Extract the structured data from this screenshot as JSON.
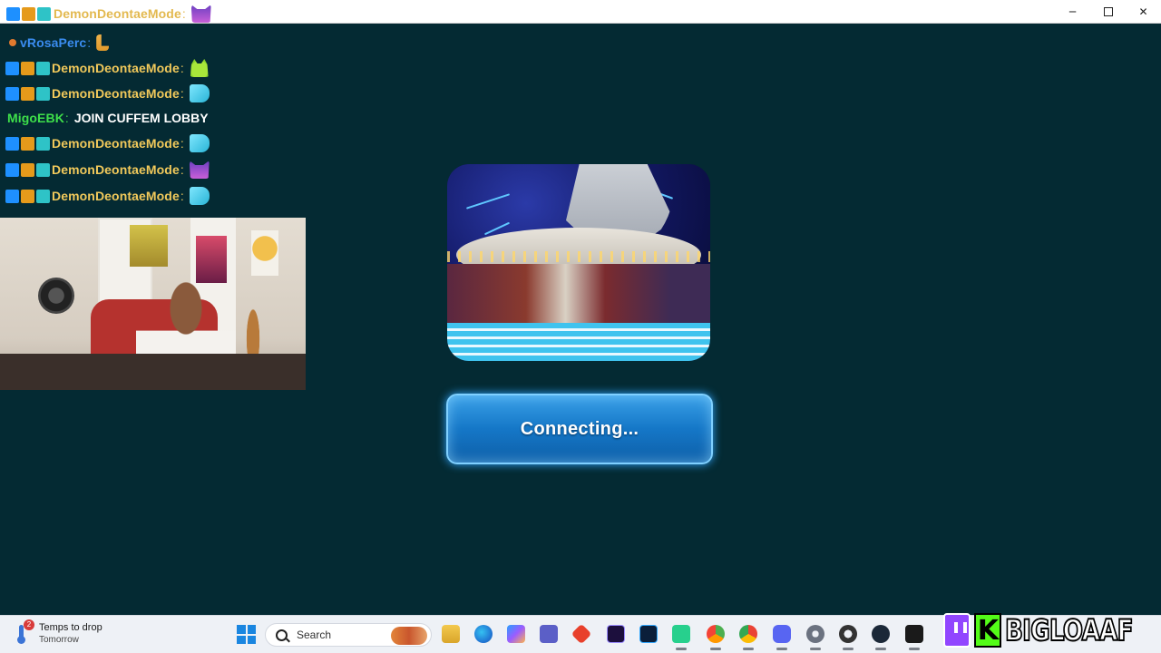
{
  "window": {
    "title_user": "DemonDeontaeMode",
    "title_colon": ":",
    "controls": {
      "minimize": "─",
      "close": "✕"
    }
  },
  "chat": {
    "messages": [
      {
        "user": "vRosaPerc",
        "colon": ":",
        "text": "",
        "user_color": "#3a8cf0",
        "emote": "L-emote"
      },
      {
        "user": "DemonDeontaeMode",
        "colon": ":",
        "text": "",
        "user_color": "#f1c95b",
        "emote": "green-creature-emote"
      },
      {
        "user": "DemonDeontaeMode",
        "colon": ":",
        "text": "",
        "user_color": "#f1c95b",
        "emote": "mask-emote"
      },
      {
        "user": "MigoEBK",
        "colon": ":",
        "text": "JOIN CUFFEM LOBBY",
        "user_color": "#3ee04a",
        "emote": ""
      },
      {
        "user": "DemonDeontaeMode",
        "colon": ":",
        "text": "",
        "user_color": "#f1c95b",
        "emote": "mask-emote"
      },
      {
        "user": "DemonDeontaeMode",
        "colon": ":",
        "text": "",
        "user_color": "#f1c95b",
        "emote": "devil-emote"
      },
      {
        "user": "DemonDeontaeMode",
        "colon": ":",
        "text": "",
        "user_color": "#f1c95b",
        "emote": "mask-emote"
      }
    ]
  },
  "loading": {
    "button_label": "Connecting..."
  },
  "taskbar": {
    "weather": {
      "title": "Temps to drop",
      "subtitle": "Tomorrow",
      "badge": "2"
    },
    "search_placeholder": "Search",
    "apps": [
      "file-explorer",
      "edge",
      "copilot",
      "teams",
      "git",
      "premiere-pro",
      "photoshop",
      "streamlabs",
      "chrome-dev",
      "chrome",
      "discord",
      "settings",
      "obs",
      "steam",
      "vrchat"
    ]
  },
  "brand": {
    "name": "BIGLOAAF",
    "kick_letter": "K"
  },
  "colors": {
    "background": "#042a33",
    "button": "#1577c7",
    "accent_glow": "#2fa6ff"
  }
}
